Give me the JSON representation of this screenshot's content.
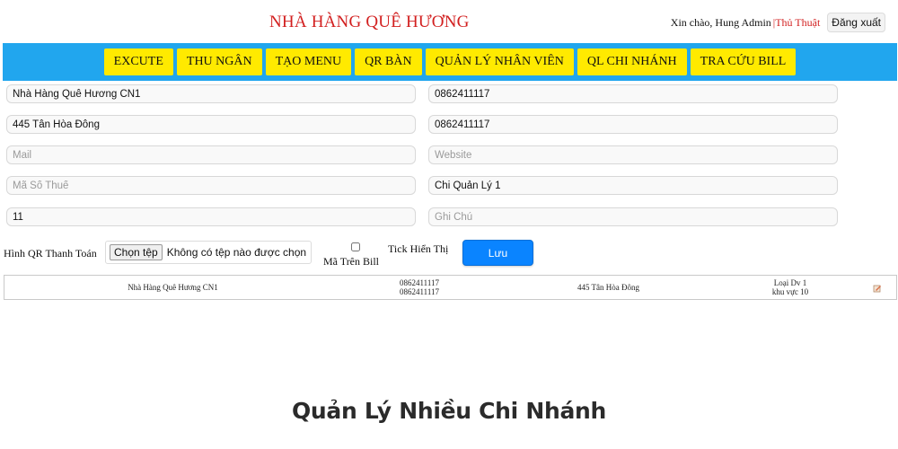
{
  "header": {
    "brand": "NHÀ HÀNG QUÊ HƯƠNG",
    "greeting": "Xin chào, Hung Admin",
    "separator": "|",
    "trick_link": "Thủ Thuật",
    "logout_label": "Đăng xuất"
  },
  "nav": {
    "items": [
      {
        "label": "EXCUTE"
      },
      {
        "label": "THU NGÂN"
      },
      {
        "label": "TẠO MENU"
      },
      {
        "label": "QR BÀN"
      },
      {
        "label": "QUẢN LÝ NHÂN VIÊN"
      },
      {
        "label": "QL CHI NHÁNH"
      },
      {
        "label": "TRA CỨU BILL"
      }
    ]
  },
  "form": {
    "name": {
      "value": "Nhà Hàng Quê Hương CN1",
      "placeholder": ""
    },
    "phone1": {
      "value": "0862411117",
      "placeholder": ""
    },
    "address": {
      "value": "445 Tân Hòa Đông",
      "placeholder": ""
    },
    "phone2": {
      "value": "0862411117",
      "placeholder": ""
    },
    "mail": {
      "value": "",
      "placeholder": "Mail"
    },
    "website": {
      "value": "",
      "placeholder": "Website"
    },
    "tax": {
      "value": "",
      "placeholder": "Mã Số Thuế"
    },
    "manager": {
      "value": "Chi Quản Lý 1",
      "placeholder": ""
    },
    "number": {
      "value": "11",
      "placeholder": ""
    },
    "note": {
      "value": "",
      "placeholder": "Ghi Chú"
    },
    "qr_label": "Hình QR Thanh Toán",
    "file_button": "Chọn tệp",
    "file_status": "Không có tệp nào được chọn",
    "checkbox_label": "Mã Trên Bill",
    "tick_label": "Tick Hiển Thị",
    "save_label": "Lưu"
  },
  "table": {
    "rows": [
      {
        "name": "Nhà Hàng Quê Hương CN1",
        "phone1": "0862411117",
        "phone2": "0862411117",
        "address": "445 Tân Hòa Đông",
        "type": "Loại Dv 1",
        "area": "khu vực 10",
        "edit_icon": "edit-icon"
      }
    ]
  },
  "caption": "Quản Lý Nhiều Chi Nhánh",
  "colors": {
    "brand": "#d21f1f",
    "navbar": "#21a6ee",
    "nav_button": "#ffea00",
    "save_button": "#0a84ff"
  }
}
